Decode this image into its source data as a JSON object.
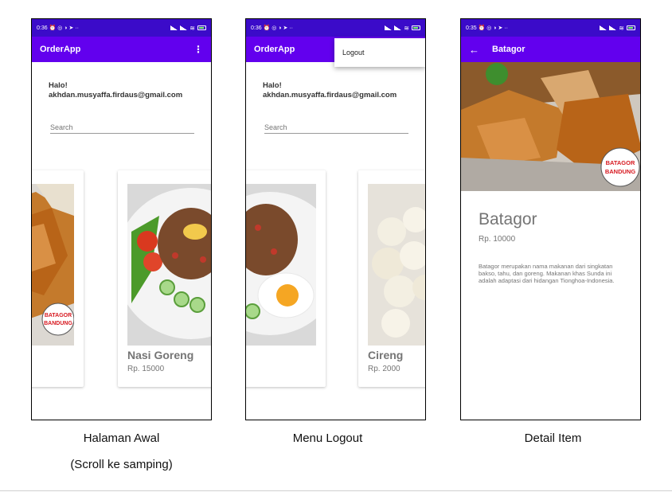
{
  "colors": {
    "statusbar": "#3b0bc9",
    "appbar": "#6200ee",
    "muted_text": "#757575"
  },
  "screen1": {
    "statusbar": {
      "time": "0:36",
      "left_icons": "⏰ ◎ ◑ ➤ ··"
    },
    "appbar": {
      "title": "OrderApp",
      "menu_icon": "⋮"
    },
    "greeting_line1": "Halo!",
    "greeting_line2": "akhdan.musyaffa.firdaus@gmail.com",
    "search_placeholder": "Search",
    "cards": [
      {
        "name": "",
        "price": "",
        "image": "batagor"
      },
      {
        "name": "Nasi Goreng",
        "price": "Rp. 15000",
        "image": "nasi-goreng"
      }
    ]
  },
  "screen2": {
    "statusbar": {
      "time": "0:36",
      "left_icons": "⏰ ◎ ◑ ➤ ··"
    },
    "appbar": {
      "title": "OrderApp"
    },
    "greeting_line1": "Halo!",
    "greeting_line2": "akhdan.musyaffa.firdaus@gmail.com",
    "search_placeholder": "Search",
    "menu_item": "Logout",
    "cards": [
      {
        "name": "",
        "price": "",
        "image": "nasi-goreng"
      },
      {
        "name": "Cireng",
        "price": "Rp. 2000",
        "image": "cireng"
      }
    ]
  },
  "screen3": {
    "statusbar": {
      "time": "0:35",
      "left_icons": "⏰ ◎ ◑ ➤ ··"
    },
    "appbar": {
      "title": "Batagor",
      "back_icon": "←"
    },
    "stamp_text": "BATAGOR BANDUNG",
    "name": "Batagor",
    "price": "Rp. 10000",
    "description": "Batagor merupakan nama makanan dari singkatan bakso, tahu, dan goreng. Makanan khas Sunda ini adalah adaptasi dari hidangan Tionghoa-Indonesia."
  },
  "captions": {
    "screen1": "Halaman Awal",
    "screen1_sub": "(Scroll ke samping)",
    "screen2": "Menu Logout",
    "screen3": "Detail Item"
  }
}
